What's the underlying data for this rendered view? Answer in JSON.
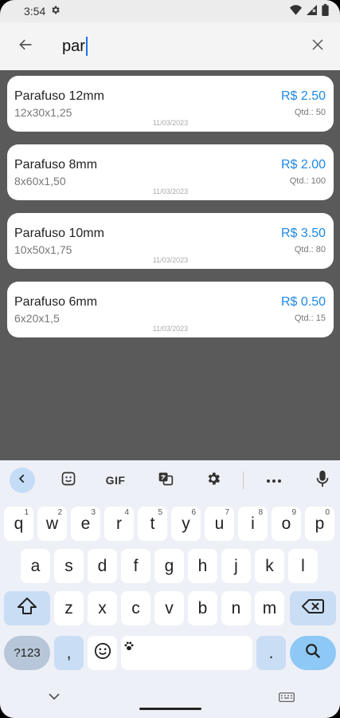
{
  "status_bar": {
    "time": "3:54"
  },
  "search": {
    "query": "par"
  },
  "products": [
    {
      "name": "Parafuso 12mm",
      "spec": "12x30x1,25",
      "price": "R$ 2.50",
      "qty": "Qtd.: 50",
      "date": "11/03/2023"
    },
    {
      "name": "Parafuso 8mm",
      "spec": "8x60x1,50",
      "price": "R$ 2.00",
      "qty": "Qtd.: 100",
      "date": "11/03/2023"
    },
    {
      "name": "Parafuso 10mm",
      "spec": "10x50x1,75",
      "price": "R$ 3.50",
      "qty": "Qtd.: 80",
      "date": "11/03/2023"
    },
    {
      "name": "Parafuso 6mm",
      "spec": "6x20x1,5",
      "price": "R$ 0.50",
      "qty": "Qtd.: 15",
      "date": "11/03/2023"
    }
  ],
  "colors": {
    "price": "#1e88e5",
    "app_background": "#5a5a5a",
    "keyboard_background": "#eef0f7"
  },
  "keyboard": {
    "toolbar": {
      "gif_label": "GIF"
    },
    "row1": [
      {
        "label": "q",
        "hint": "1"
      },
      {
        "label": "w",
        "hint": "2"
      },
      {
        "label": "e",
        "hint": "3"
      },
      {
        "label": "r",
        "hint": "4"
      },
      {
        "label": "t",
        "hint": "5"
      },
      {
        "label": "y",
        "hint": "6"
      },
      {
        "label": "u",
        "hint": "7"
      },
      {
        "label": "i",
        "hint": "8"
      },
      {
        "label": "o",
        "hint": "9"
      },
      {
        "label": "p",
        "hint": "0"
      }
    ],
    "row2": [
      "a",
      "s",
      "d",
      "f",
      "g",
      "h",
      "j",
      "k",
      "l"
    ],
    "row3": [
      "z",
      "x",
      "c",
      "v",
      "b",
      "n",
      "m"
    ],
    "symbols_label": "?123",
    "comma": ",",
    "period": "."
  }
}
